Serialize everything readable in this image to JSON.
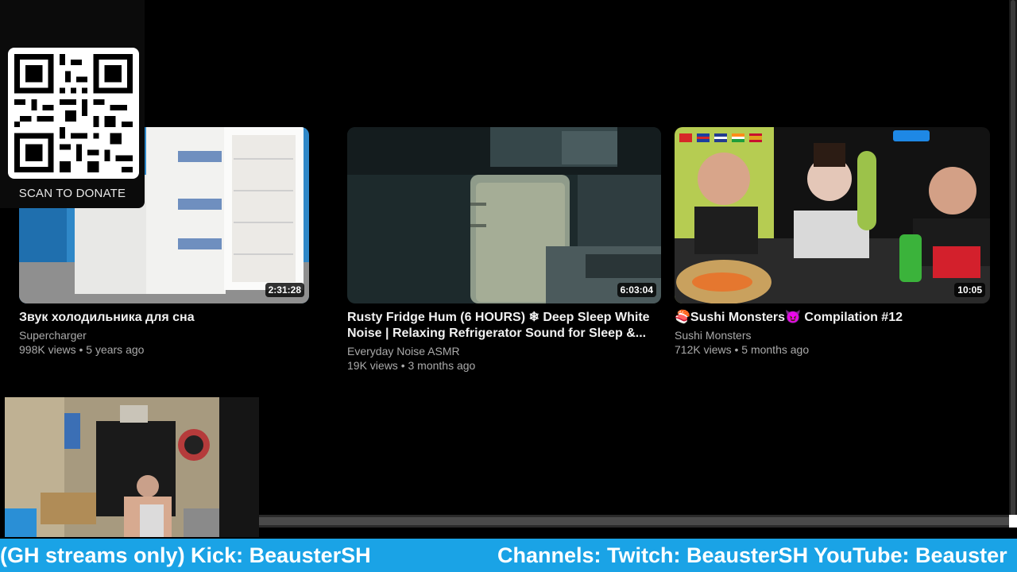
{
  "donate": {
    "label": "SCAN TO DONATE"
  },
  "videos": [
    {
      "title": "Звук холодильника для сна",
      "channel": "Supercharger",
      "meta": "998K views • 5 years ago",
      "duration": "2:31:28"
    },
    {
      "title": "Rusty Fridge Hum (6 HOURS) ❄ Deep Sleep White Noise | Relaxing Refrigerator Sound for Sleep &...",
      "channel": "Everyday Noise ASMR",
      "meta": "19K views • 3 months ago",
      "duration": "6:03:04"
    },
    {
      "title": "🍣Sushi Monsters😈 Compilation #12",
      "channel": "Sushi Monsters",
      "meta": "712K views • 5 months ago",
      "duration": "10:05"
    }
  ],
  "ticker": {
    "left": "(GH streams only) Kick: BeausterSH",
    "right": "Channels: Twitch: BeausterSH YouTube: Beauster"
  },
  "colors": {
    "ticker_bg": "#1aa3e6",
    "background": "#000000"
  }
}
